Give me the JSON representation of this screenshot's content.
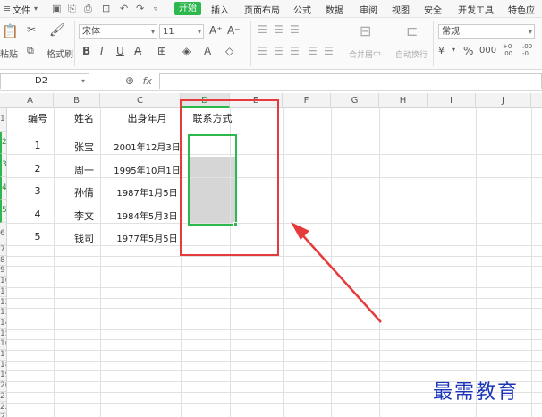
{
  "menu": {
    "file": "文件",
    "start": "开始",
    "tabs": [
      "插入",
      "页面布局",
      "公式",
      "数据",
      "审阅",
      "视图",
      "安全",
      "开发工具",
      "特色应"
    ]
  },
  "ribbon": {
    "paste": "粘贴",
    "format_painter": "格式刷",
    "font_name": "宋体",
    "font_size": "11",
    "merge_center": "合并居中",
    "auto_wrap": "自动换行",
    "number_format": "常规",
    "percent": "%",
    "thousands": "000"
  },
  "formula_bar": {
    "name_box": "D2",
    "fx": "fx"
  },
  "columns": [
    "A",
    "B",
    "C",
    "D",
    "E",
    "F",
    "G",
    "H",
    "I",
    "J"
  ],
  "active_column": "D",
  "rows": [
    "1",
    "2",
    "3",
    "4",
    "5",
    "6",
    "7",
    "8",
    "9",
    "10",
    "11",
    "12",
    "13",
    "14",
    "15",
    "16",
    "17",
    "18",
    "19",
    "20",
    "21",
    "22",
    "23"
  ],
  "headers": {
    "id": "编号",
    "name": "姓名",
    "birth": "出身年月",
    "contact": "联系方式"
  },
  "table": [
    {
      "id": "1",
      "name": "张宝",
      "birth": "2001年12月3日"
    },
    {
      "id": "2",
      "name": "周一",
      "birth": "1995年10月1日"
    },
    {
      "id": "3",
      "name": "孙倩",
      "birth": "1987年1月5日"
    },
    {
      "id": "4",
      "name": "李文",
      "birth": "1984年5月3日"
    },
    {
      "id": "5",
      "name": "钱司",
      "birth": "1977年5月5日"
    }
  ],
  "watermark": "最需教育",
  "colors": {
    "accent_green": "#2db84d",
    "annotation_red": "#e63b3b",
    "watermark_blue": "#1a35b8"
  }
}
